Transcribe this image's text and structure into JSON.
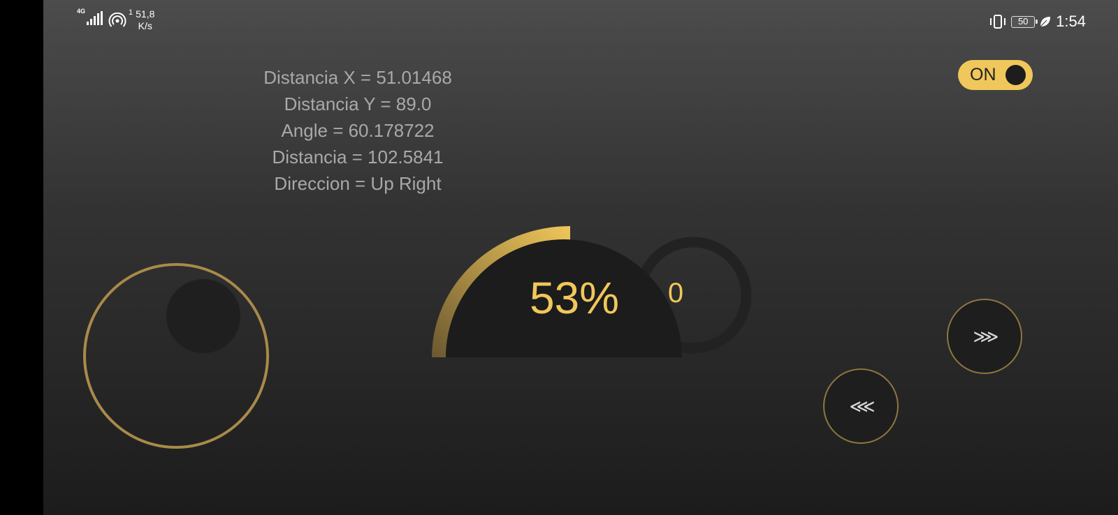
{
  "status_bar": {
    "network_type": "4G",
    "hotspot_count": "1",
    "speed_value": "51,8",
    "speed_unit": "K/s",
    "battery_level": "50",
    "time": "1:54"
  },
  "readouts": {
    "distance_x": "Distancia X = 51.01468",
    "distance_y": "Distancia Y = 89.0",
    "angle": "Angle = 60.178722",
    "distance": "Distancia = 102.5841",
    "direction": "Direccion = Up Right"
  },
  "power_toggle": {
    "label": "ON",
    "state": "on"
  },
  "gauge": {
    "percent_label": "53%",
    "percent_value": 53,
    "counter": "0"
  },
  "buttons": {
    "forward_label": "⋙",
    "back_label": "⋘"
  },
  "colors": {
    "accent": "#f0c75a",
    "ring": "#a88a4a",
    "text_dim": "#a9a9a9"
  }
}
